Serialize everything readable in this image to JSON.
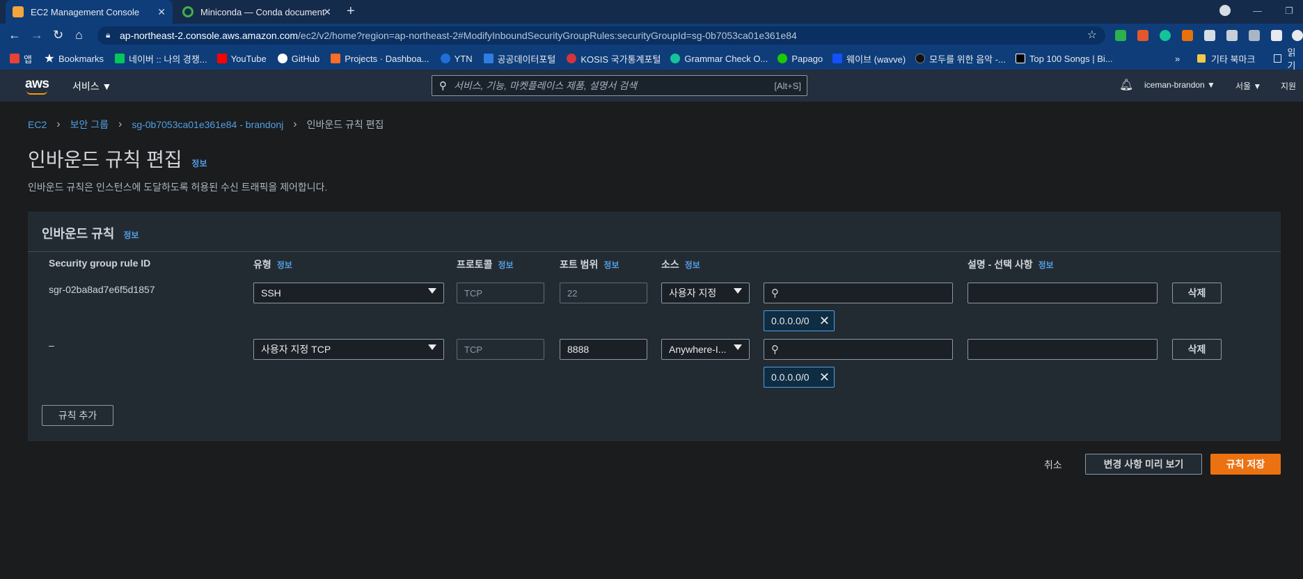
{
  "browser": {
    "tabs": [
      {
        "title": "EC2 Management Console",
        "favicon_color": "#f4a53b"
      },
      {
        "title": "Miniconda — Conda document",
        "favicon_color": "#43b049"
      }
    ],
    "url": {
      "host": "ap-northeast-2.console.aws.amazon.com",
      "path": "/ec2/v2/home?region=ap-northeast-2#ModifyInboundSecurityGroupRules:securityGroupId=sg-0b7053ca01e361e84"
    },
    "bookmarks": [
      {
        "label": "앱",
        "color": "#e94235"
      },
      {
        "label": "Bookmarks",
        "color": "#ffffff"
      },
      {
        "label": "네이버 :: 나의 경쟁...",
        "color": "#03c75a"
      },
      {
        "label": "YouTube",
        "color": "#ff0000"
      },
      {
        "label": "GitHub",
        "color": "#ffffff"
      },
      {
        "label": "Projects · Dashboa...",
        "color": "#fc6d26"
      },
      {
        "label": "YTN",
        "color": "#1f6fd6"
      },
      {
        "label": "공공데이터포털",
        "color": "#2f7de1"
      },
      {
        "label": "KOSIS 국가통계포털",
        "color": "#d6343a"
      },
      {
        "label": "Grammar Check O...",
        "color": "#15c39a"
      },
      {
        "label": "Papago",
        "color": "#1ec800"
      },
      {
        "label": "웨이브 (wavve)",
        "color": "#1351f9"
      },
      {
        "label": "모두를 위한 음악 -...",
        "color": "#111111"
      },
      {
        "label": "Top 100 Songs | Bi...",
        "color": "#000000"
      }
    ],
    "bookmarks_more": "»",
    "other_bookmarks": "기타 북마크",
    "reading_list": "읽기"
  },
  "aws_header": {
    "logo": "aws",
    "services_label": "서비스",
    "search_placeholder": "서비스, 기능, 마켓플레이스 제품, 설명서 검색",
    "search_shortcut": "[Alt+S]",
    "account": "iceman-brandon",
    "region": "서울",
    "support": "지원"
  },
  "breadcrumb": {
    "ec2": "EC2",
    "security_groups": "보안 그룹",
    "sg": "sg-0b7053ca01e361e84 - brandonj",
    "current": "인바운드 규칙 편집"
  },
  "page": {
    "title": "인바운드 규칙 편집",
    "info": "정보",
    "description": "인바운드 규칙은 인스턴스에 도달하도록 허용된 수신 트래픽을 제어합니다."
  },
  "panel": {
    "title": "인바운드 규칙",
    "info": "정보",
    "columns": {
      "rule_id": "Security group rule ID",
      "type": "유형",
      "protocol": "프로토콜",
      "port_range": "포트 범위",
      "source": "소스",
      "description": "설명 - 선택 사항",
      "info": "정보"
    },
    "rules": [
      {
        "rule_id": "sgr-02ba8ad7e6f5d1857",
        "type": "SSH",
        "protocol": "TCP",
        "port_range": "22",
        "source_type": "사용자 지정",
        "cidr": "0.0.0.0/0",
        "delete_label": "삭제"
      },
      {
        "rule_id": "–",
        "type": "사용자 지정 TCP",
        "protocol": "TCP",
        "port_range": "8888",
        "source_type": "Anywhere-I...",
        "cidr": "0.0.0.0/0",
        "delete_label": "삭제"
      }
    ],
    "add_rule": "규칙 추가"
  },
  "footer": {
    "cancel": "취소",
    "preview": "변경 사항 미리 보기",
    "save": "규칙 저장"
  },
  "colors": {
    "link": "#539fe5",
    "primary": "#ec7211",
    "aws_header": "#232f3e",
    "chrome": "#0e3d7a"
  }
}
